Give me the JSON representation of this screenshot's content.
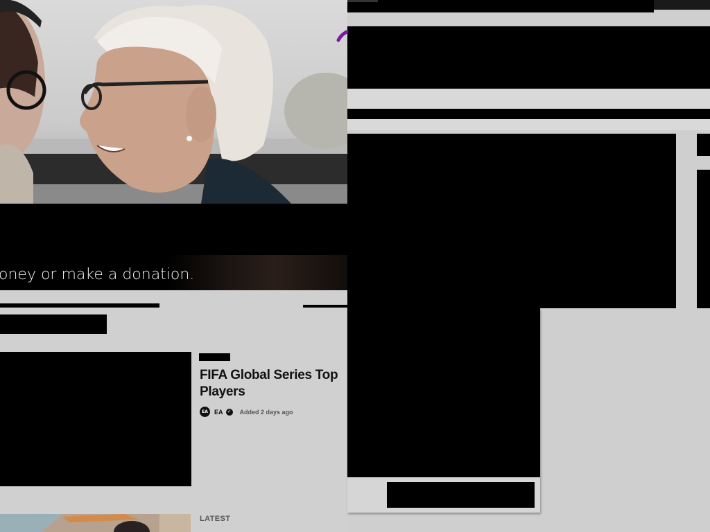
{
  "promo": {
    "text": "oney or make a donation."
  },
  "featured_article": {
    "title": "FIFA Global Series Top Players",
    "publisher": "EA",
    "publisher_logo_text": "EA",
    "verified_icon": "check-circle-icon",
    "added": "Added 2 days ago"
  },
  "latest": {
    "label": "LATEST"
  },
  "colors": {
    "page_background": "#cfcfcf",
    "redaction": "#000000",
    "promo_text": "#f2f2f2",
    "accent": "#7a1aa0"
  }
}
